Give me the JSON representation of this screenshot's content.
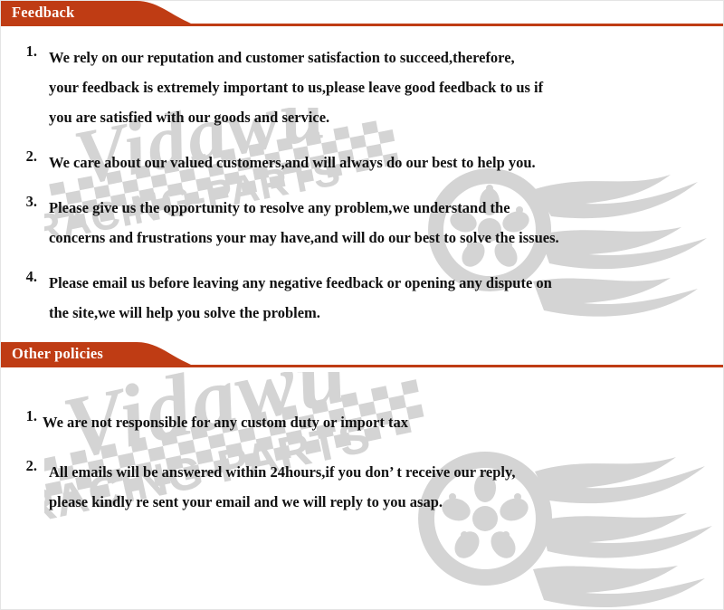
{
  "theme": {
    "banner_color": "#bf3c14",
    "banner_text_color": "#ffffff",
    "body_text_color": "#111111",
    "watermark_color": "#d4d4d4",
    "page_background": "#ffffff"
  },
  "watermark": {
    "brand_script": "Vidawu",
    "brand_sub": "RACING-PARTS",
    "icon_names": [
      "checkered-flag-icon",
      "wheel-rim-icon",
      "flame-icon"
    ]
  },
  "sections": [
    {
      "id": "feedback",
      "title": "Feedback",
      "items": [
        {
          "number": "1.",
          "lines": [
            "We rely on our reputation and customer satisfaction to succeed,therefore,",
            "your feedback is extremely important to us,please leave good feedback to us if",
            "you are satisfied with our goods and service."
          ]
        },
        {
          "number": "2.",
          "lines": [
            "We care about our valued customers,and will always do our best to help you."
          ]
        },
        {
          "number": "3.",
          "lines": [
            "Please give us the opportunity to resolve any problem,we understand the",
            "concerns and frustrations your may have,and will do our best to solve the issues."
          ]
        },
        {
          "number": "4.",
          "lines": [
            "Please email us before leaving any negative feedback or opening any dispute on",
            "the site,we will help you solve the problem."
          ]
        }
      ]
    },
    {
      "id": "other-policies",
      "title": "Other policies",
      "items": [
        {
          "number": "1.",
          "lines": [
            "We are not responsible for any custom duty or import tax"
          ]
        },
        {
          "number": "2.",
          "lines": [
            "All emails will be answered within 24hours,if you don’ t receive our reply,",
            "please kindly re sent your email and we will reply to you asap."
          ]
        }
      ]
    }
  ]
}
